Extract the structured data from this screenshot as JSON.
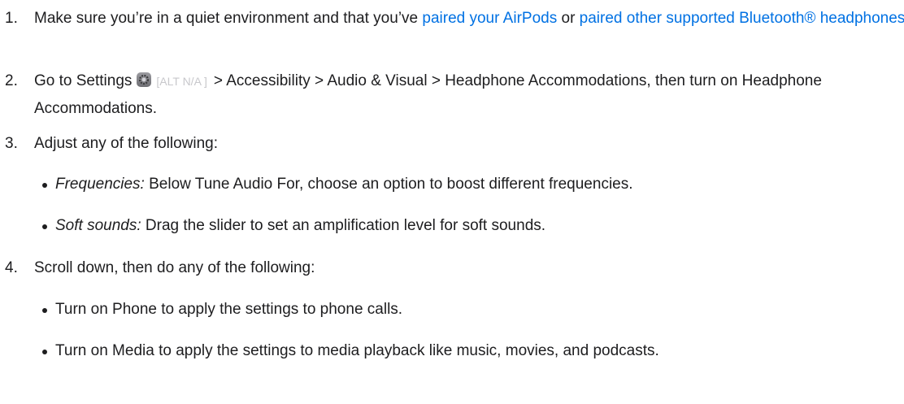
{
  "steps": [
    {
      "num": "1.",
      "line1_pre": "Make sure you’re in a quiet environment and that you’ve ",
      "link_airpods": "paired your AirPods",
      "line1_mid": " or ",
      "link_other": "paired other supported Bluetooth® headphones",
      "line1_post": "."
    },
    {
      "num": "2.",
      "pre": "Go to Settings",
      "alt": "[ALT N/A ]",
      "post": "> Accessibility > Audio & Visual > Headphone Accommodations, then turn on Headphone Accommodations."
    },
    {
      "num": "3.",
      "text": "Adjust any of the following:",
      "bullets": [
        {
          "term": "Frequencies:",
          "text": " Below Tune Audio For, choose an option to boost different frequencies."
        },
        {
          "term": "Soft sounds:",
          "text": " Drag the slider to set an amplification level for soft sounds."
        }
      ]
    },
    {
      "num": "4.",
      "text": "Scroll down, then do any of the following:",
      "bullets": [
        {
          "text": "Turn on Phone to apply the settings to phone calls."
        },
        {
          "text": "Turn on Media to apply the settings to media playback like music, movies, and podcasts."
        }
      ]
    }
  ],
  "icons": {
    "settings": "settings-gear-icon"
  },
  "colors": {
    "text": "#1d1d1f",
    "link": "#0071e3",
    "alt": "#c8c8cc"
  }
}
